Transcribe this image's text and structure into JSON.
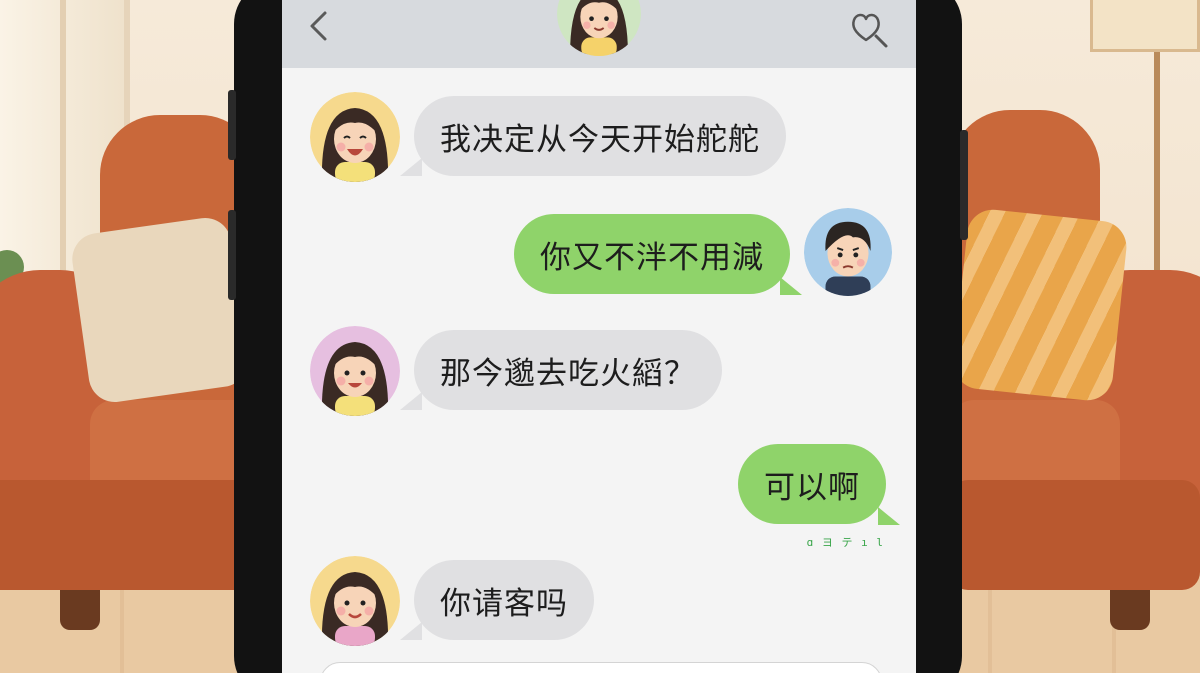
{
  "header": {
    "back_icon": "chevron-left-icon",
    "action_icon": "heart-search-icon",
    "contact_avatar": "girl-avatar"
  },
  "messages": [
    {
      "side": "left",
      "text": "我决定从今天开始舵舵",
      "avatar": "girl-avatar-laughing"
    },
    {
      "side": "right",
      "text": "你又不泮不用減",
      "avatar": "boy-avatar-worried"
    },
    {
      "side": "left",
      "text": "那今邈去吃火縚？",
      "avatar": "girl-avatar-smiling"
    },
    {
      "side": "right",
      "text": "可以啊",
      "avatar": ""
    },
    {
      "side": "left",
      "text": "你请客吗",
      "avatar": "girl-avatar-smiling"
    }
  ],
  "read_receipt": "ɑ ヨ テ ı l",
  "colors": {
    "incoming_bubble": "#e0e0e2",
    "outgoing_bubble": "#8fd36a",
    "topbar": "#d7dade",
    "sofa": "#c9683a"
  }
}
